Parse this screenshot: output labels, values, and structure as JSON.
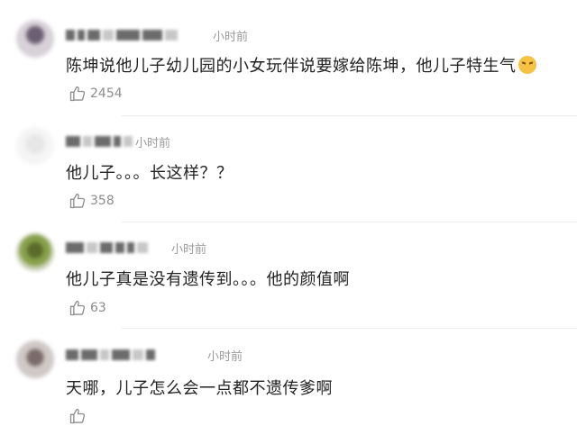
{
  "comments": [
    {
      "time": "小时前",
      "text": "陈坤说他儿子幼儿园的小女玩伴说要嫁给陈坤，他儿子特生气",
      "likes": "2454",
      "emoji": "angry-face"
    },
    {
      "time": "小时前",
      "text": "他儿子。。。长这样？？",
      "likes": "358"
    },
    {
      "time": "小时前",
      "text": "他儿子真是没有遗传到。。。他的颜值啊",
      "likes": "63"
    },
    {
      "time": "小时前",
      "text": "天哪，儿子怎么会一点都不遗传爹啊",
      "likes": ""
    }
  ]
}
